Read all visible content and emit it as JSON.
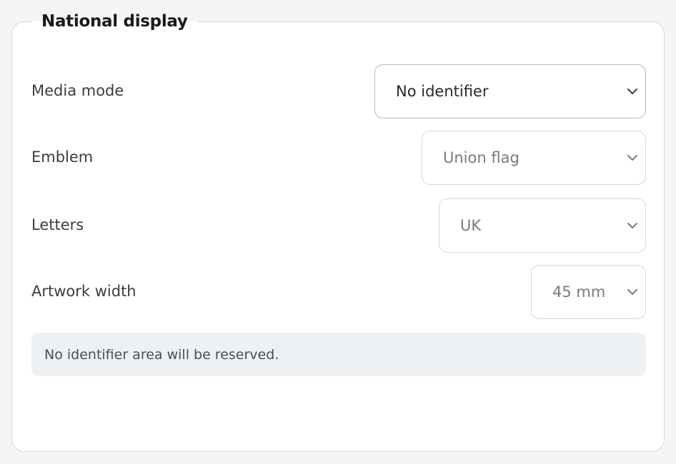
{
  "section": {
    "title": "National display"
  },
  "fields": {
    "media_mode": {
      "label": "Media mode",
      "value": "No identifier",
      "icon": "chevron-down-icon"
    },
    "emblem": {
      "label": "Emblem",
      "value": "Union flag",
      "icon": "chevron-down-icon"
    },
    "letters": {
      "label": "Letters",
      "value": "UK",
      "icon": "chevron-down-icon"
    },
    "artwork_width": {
      "label": "Artwork width",
      "value": "45 mm",
      "icon": "chevron-down-icon"
    }
  },
  "info": {
    "message": "No identifier area will be reserved."
  },
  "colors": {
    "page_background": "#f5f5f3",
    "panel_background": "#ffffff",
    "info_background": "#edf1f3",
    "enabled_text": "#2a2a2a",
    "disabled_text": "#7a7a7a"
  }
}
